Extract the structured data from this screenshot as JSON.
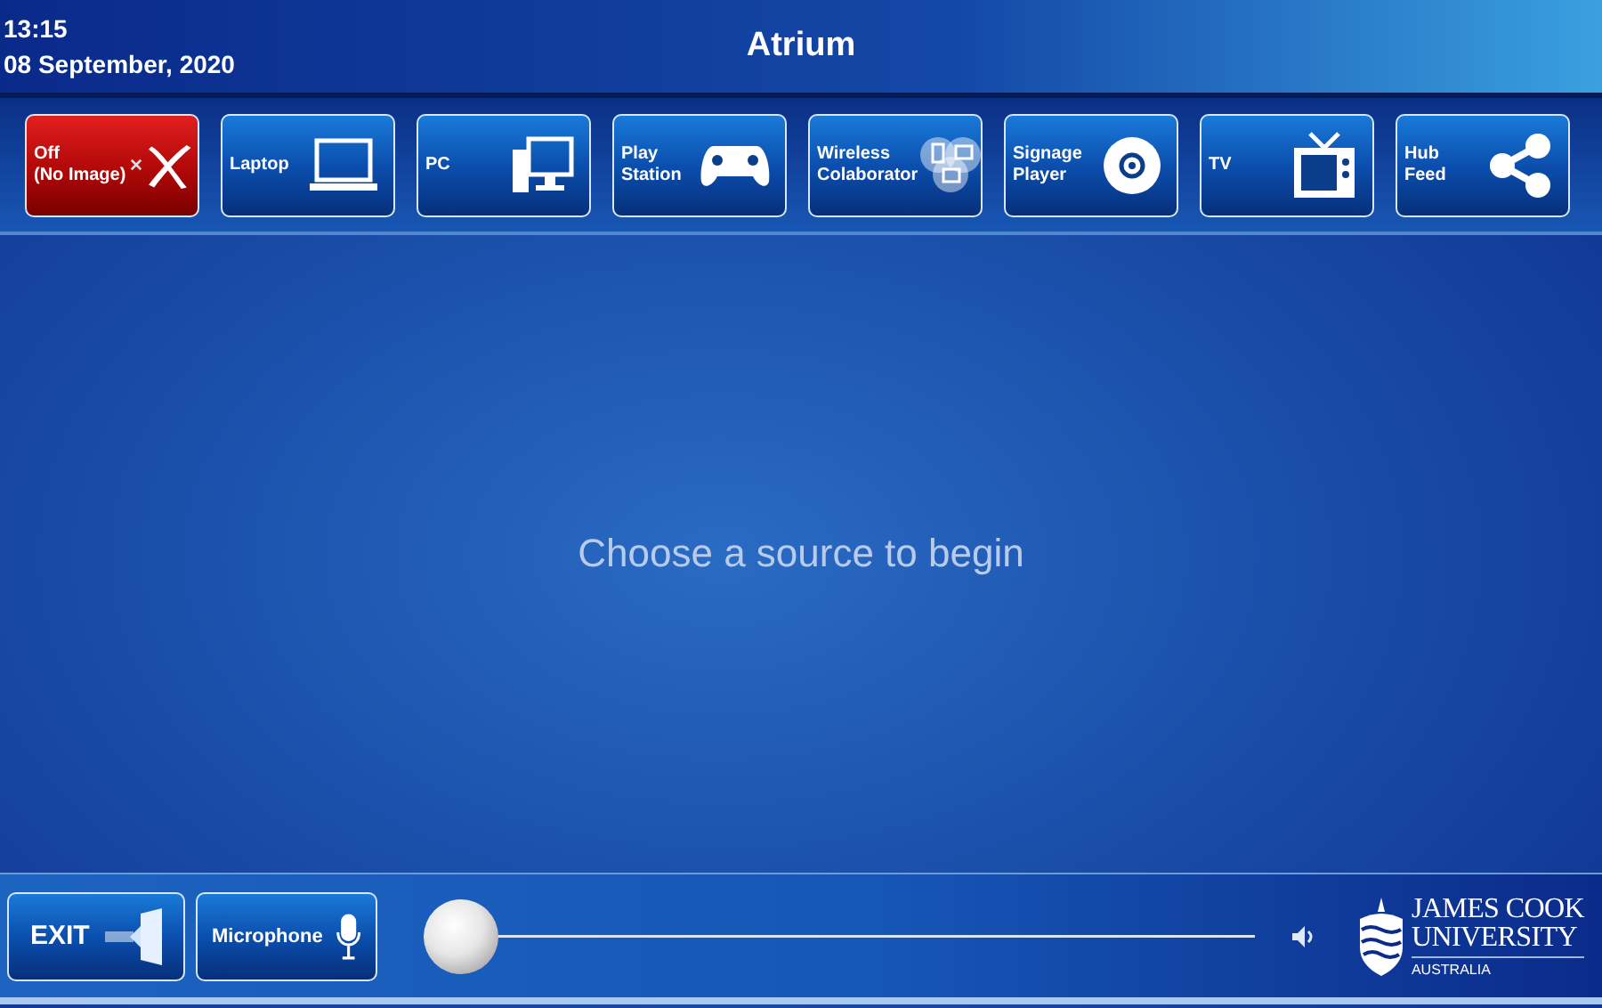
{
  "header": {
    "time": "13:15",
    "date": "08 September, 2020",
    "title": "Atrium"
  },
  "sources": [
    {
      "label": "Off\n(No Image)",
      "kind": "off",
      "selected": true
    },
    {
      "label": "Laptop",
      "kind": "laptop",
      "selected": false
    },
    {
      "label": "PC",
      "kind": "pc",
      "selected": false
    },
    {
      "label": "Play\nStation",
      "kind": "gamepad",
      "selected": false
    },
    {
      "label": "Wireless\nColaborator",
      "kind": "wireless",
      "selected": false
    },
    {
      "label": "Signage\nPlayer",
      "kind": "disc",
      "selected": false
    },
    {
      "label": "TV",
      "kind": "tv",
      "selected": false
    },
    {
      "label": "Hub\nFeed",
      "kind": "share",
      "selected": false
    }
  ],
  "message": "Choose a source to begin",
  "footer": {
    "exit": "EXIT",
    "microphone": "Microphone",
    "volume": {
      "level": 0
    },
    "logo": {
      "line_1": "JAMES COOK",
      "line_2": "UNIVERSITY",
      "line_3": "AUSTRALIA"
    }
  }
}
